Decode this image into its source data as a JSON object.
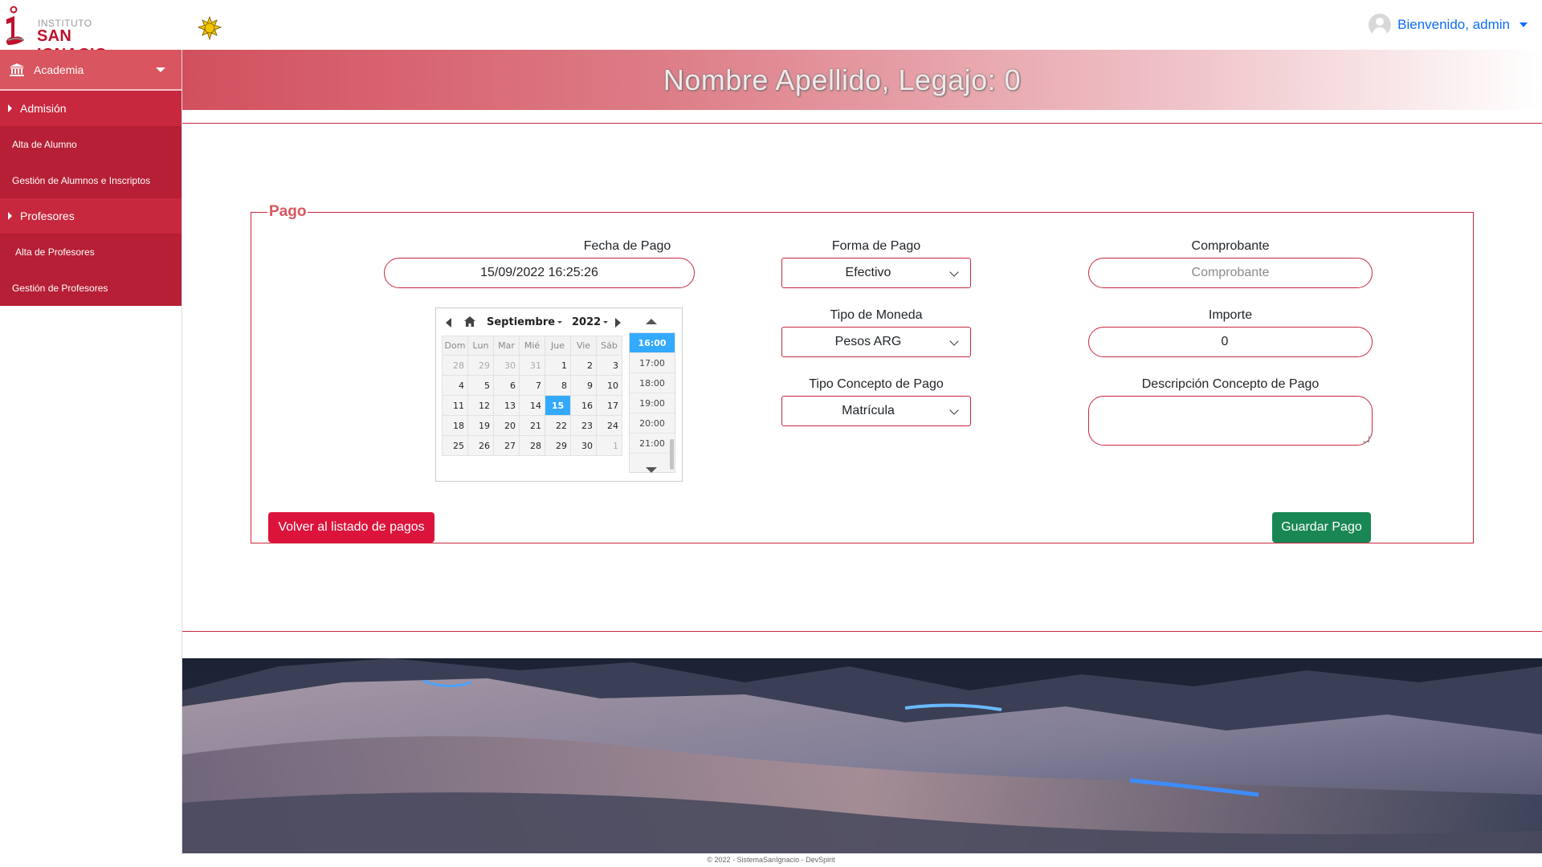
{
  "brand": {
    "small": "INSTITUTO",
    "big": "SAN IGNACIO"
  },
  "user": {
    "greeting": "Bienvenido, admin"
  },
  "sidebar": {
    "section": "Academia",
    "groups": [
      {
        "label": "Admisión",
        "items": [
          "Alta de Alumno",
          "Gestión de Alumnos e Inscriptos"
        ]
      },
      {
        "label": "Profesores",
        "items": [
          "Alta de Profesores",
          "Gestión de Profesores"
        ]
      }
    ]
  },
  "banner": {
    "title": "Nombre Apellido, Legajo: 0"
  },
  "form": {
    "legend": "Pago",
    "fecha_label": "Fecha de Pago",
    "fecha_value": "15/09/2022 16:25:26",
    "forma_label": "Forma de Pago",
    "forma_value": "Efectivo",
    "moneda_label": "Tipo de Moneda",
    "moneda_value": "Pesos ARG",
    "concepto_label": "Tipo Concepto de Pago",
    "concepto_value": "Matrícula",
    "comprobante_label": "Comprobante",
    "comprobante_placeholder": "Comprobante",
    "importe_label": "Importe",
    "importe_value": "0",
    "descripcion_label": "Descripción Concepto de Pago",
    "back_button": "Volver al listado de pagos",
    "save_button": "Guardar Pago"
  },
  "datepicker": {
    "month": "Septiembre",
    "year": "2022",
    "weekdays": [
      "Dom",
      "Lun",
      "Mar",
      "Mié",
      "Jue",
      "Vie",
      "Sáb"
    ],
    "weeks": [
      [
        "28",
        "29",
        "30",
        "31",
        "1",
        "2",
        "3"
      ],
      [
        "4",
        "5",
        "6",
        "7",
        "8",
        "9",
        "10"
      ],
      [
        "11",
        "12",
        "13",
        "14",
        "15",
        "16",
        "17"
      ],
      [
        "18",
        "19",
        "20",
        "21",
        "22",
        "23",
        "24"
      ],
      [
        "25",
        "26",
        "27",
        "28",
        "29",
        "30",
        "1"
      ]
    ],
    "selected_day": "15",
    "times": [
      "16:00",
      "17:00",
      "18:00",
      "19:00",
      "20:00",
      "21:00"
    ],
    "selected_time": "16:00"
  },
  "footer": "© 2022 - SistemaSanIgnacio - DevSpirit",
  "colors": {
    "brand_red": "#c8283e",
    "link_blue": "#0d6efd",
    "danger": "#dc143c",
    "success": "#198754",
    "picker_selected": "#33aaff"
  }
}
